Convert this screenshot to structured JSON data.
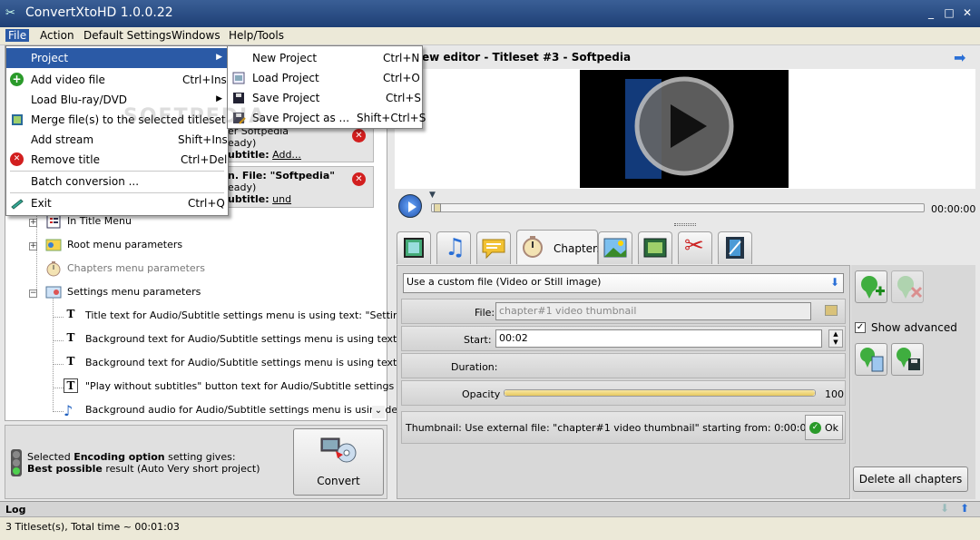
{
  "window": {
    "title": "ConvertXtoHD 1.0.0.22",
    "min": "_",
    "max": "□",
    "close": "✕"
  },
  "menubar": {
    "items": [
      "File",
      "Action",
      "Default Settings",
      "Windows",
      "Help/Tools"
    ]
  },
  "file_menu": {
    "items": [
      {
        "label": "Project",
        "shortcut": ""
      },
      {
        "label": "Add video file",
        "shortcut": "Ctrl+Ins"
      },
      {
        "label": "Load Blu-ray/DVD",
        "shortcut": ""
      },
      {
        "label": "Merge file(s) to the selected titleset",
        "shortcut": ""
      },
      {
        "label": "Add stream",
        "shortcut": "Shift+Ins"
      },
      {
        "label": "Remove title",
        "shortcut": "Ctrl+Del"
      },
      {
        "label": "Batch conversion ...",
        "shortcut": ""
      },
      {
        "label": "Exit",
        "shortcut": "Ctrl+Q"
      }
    ]
  },
  "project_menu": {
    "items": [
      {
        "label": "New Project",
        "shortcut": "Ctrl+N"
      },
      {
        "label": "Load Project",
        "shortcut": "Ctrl+O"
      },
      {
        "label": "Save Project",
        "shortcut": "Ctrl+S"
      },
      {
        "label": "Save Project as ...",
        "shortcut": "Shift+Ctrl+S"
      }
    ]
  },
  "cards": [
    {
      "line1": "er Softpedia",
      "line2": "eady)",
      "sub_label": "ubtitle:",
      "sub_value": "Add..."
    },
    {
      "line1": "n. File: \"Softpedia\"",
      "line2": "eady)",
      "sub_label": "ubtitle:",
      "sub_value": "und"
    }
  ],
  "tree": {
    "items": [
      {
        "label": "In Title Menu"
      },
      {
        "label": "Root menu parameters"
      },
      {
        "label": "Chapters menu parameters"
      },
      {
        "label": "Settings menu parameters"
      }
    ],
    "children": [
      {
        "label": "Title text for Audio/Subtitle settings menu is using text: \"Settin..."
      },
      {
        "label": "Background text for Audio/Subtitle settings menu is using text:..."
      },
      {
        "label": "Background text for Audio/Subtitle settings menu is using text:..."
      },
      {
        "label": "\"Play without subtitles\" button text for Audio/Subtitle settings ..."
      },
      {
        "label": "Background audio for Audio/Subtitle settings menu is using def..."
      }
    ]
  },
  "encoding": {
    "line1_pre": "Selected ",
    "line1_bold": "Encoding option",
    "line1_post": " setting gives:",
    "line2_bold": "Best possible",
    "line2_post": " result (Auto Very short project)"
  },
  "convert": {
    "label": "Convert"
  },
  "preview": {
    "title": "ew editor - Titleset #3 - Softpedia",
    "time": "00:00:00"
  },
  "tabs": {
    "selected_label": "Chapters"
  },
  "editor": {
    "source_select": "Use a custom file (Video or Still image)",
    "file_label": "File:",
    "file_placeholder": "chapter#1 video thumbnail",
    "start_label": "Start:",
    "start_value": "00:02",
    "duration_label": "Duration:",
    "opacity_label": "Opacity",
    "opacity_value": "100",
    "opacity": 1.0,
    "thumbnail_text": "Thumbnail: Use external file: \"chapter#1 video thumbnail\" starting from: 0:00:02",
    "ok_label": "Ok"
  },
  "side": {
    "show_advanced": "Show advanced",
    "delete_all": "Delete all chapters"
  },
  "log": {
    "label": "Log"
  },
  "status": {
    "text": "3 Titleset(s), Total time ~ 00:01:03"
  },
  "watermark": "SOFTPEDIA",
  "colors": {
    "titlebar": "#1e3f75",
    "menu_highlight": "#2b5aa6",
    "remove": "#d21f1f",
    "ok": "#2a9a2a",
    "green_pin": "#3fae3f"
  }
}
